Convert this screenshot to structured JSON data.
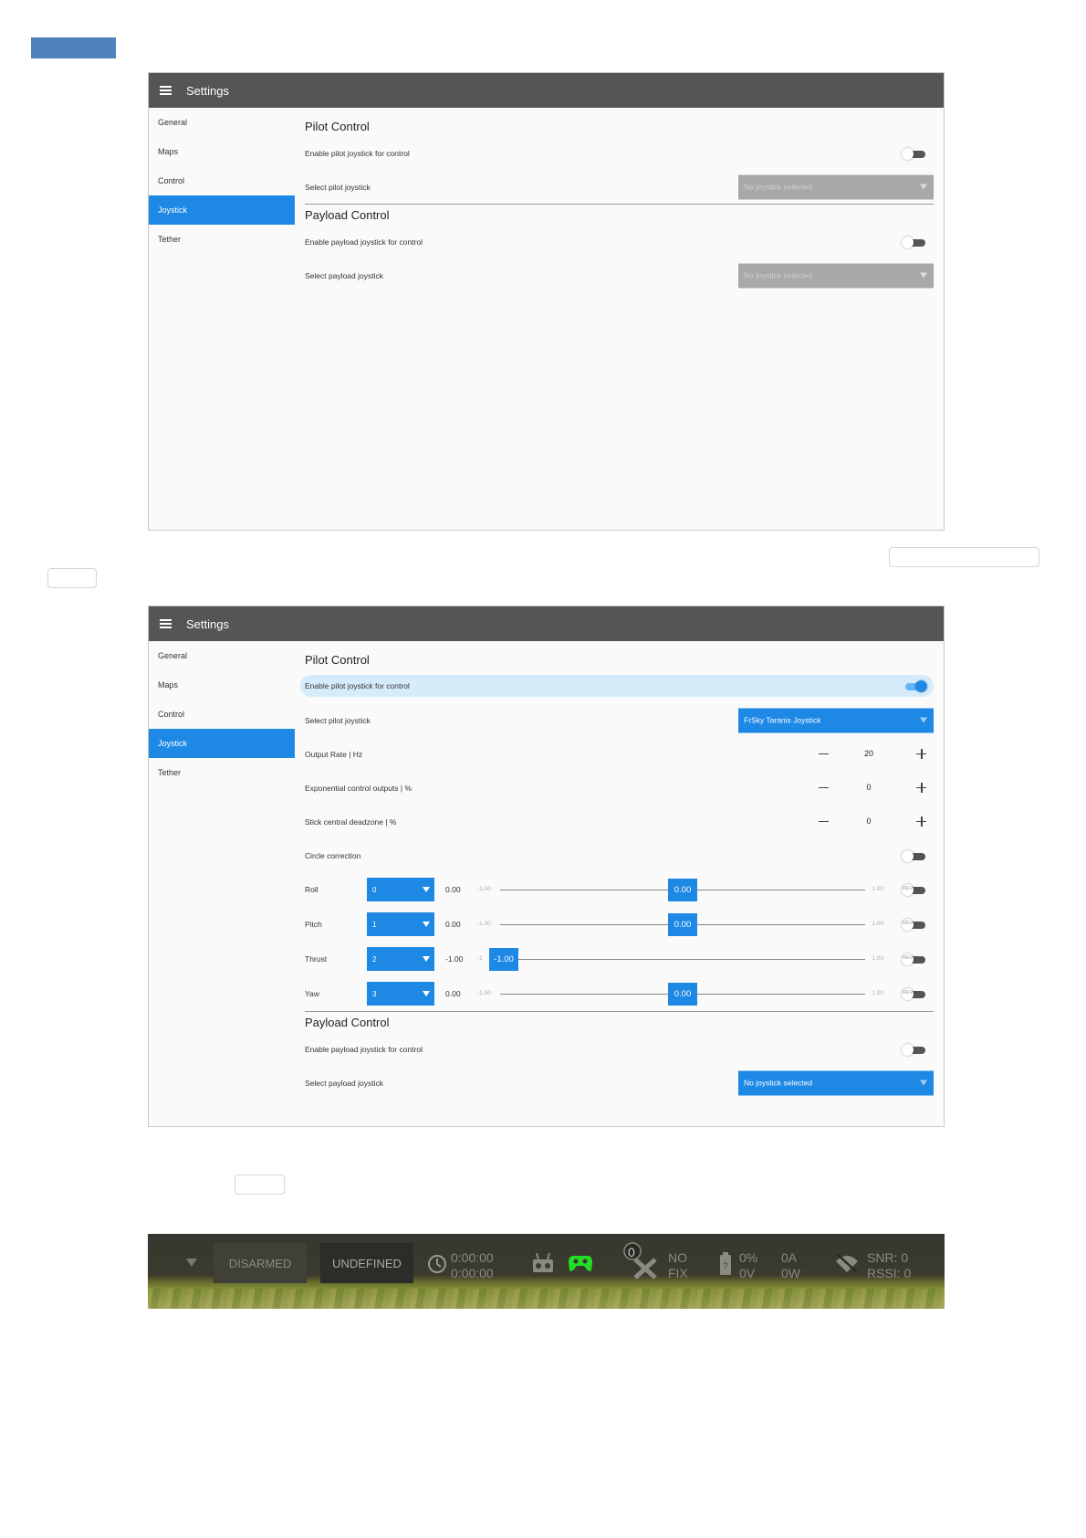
{
  "panel1": {
    "title": "Settings",
    "sidebar": [
      "General",
      "Maps",
      "Control",
      "Joystick",
      "Tether"
    ],
    "pilot": {
      "heading": "Pilot Control",
      "enable_label": "Enable pilot joystick for control",
      "select_label": "Select pilot joystick",
      "select_value": "No joystick selected"
    },
    "payload": {
      "heading": "Payload Control",
      "enable_label": "Enable payload joystick for control",
      "select_label": "Select payload joystick",
      "select_value": "No joystick selected"
    }
  },
  "panel2": {
    "title": "Settings",
    "sidebar": [
      "General",
      "Maps",
      "Control",
      "Joystick",
      "Tether"
    ],
    "pilot": {
      "heading": "Pilot Control",
      "enable_label": "Enable pilot joystick for control",
      "select_label": "Select pilot joystick",
      "select_value": "FrSky Taranis Joystick",
      "output_rate_label": "Output Rate | Hz",
      "output_rate_value": "20",
      "expo_label": "Exponential control outputs | %",
      "expo_value": "0",
      "deadzone_label": "Stick central deadzone | %",
      "deadzone_value": "0",
      "circle_label": "Circle correction"
    },
    "axes": [
      {
        "label": "Roll",
        "channel": "0",
        "value": "0.00",
        "min": "-1.00",
        "max": "1.00",
        "thumb": "0.00",
        "level": 0.0,
        "rev": "REV"
      },
      {
        "label": "Pitch",
        "channel": "1",
        "value": "0.00",
        "min": "-1.00",
        "max": "1.00",
        "thumb": "0.00",
        "level": 0.0,
        "rev": "REV"
      },
      {
        "label": "Thrust",
        "channel": "2",
        "value": "-1.00",
        "min": "-1",
        "max": "1.00",
        "thumb": "-1.00",
        "level": -1.0,
        "rev": "REV"
      },
      {
        "label": "Yaw",
        "channel": "3",
        "value": "0.00",
        "min": "-1.00",
        "max": "1.00",
        "thumb": "0.00",
        "level": 0.0,
        "rev": "REV"
      }
    ],
    "payload": {
      "heading": "Payload Control",
      "enable_label": "Enable payload joystick for control",
      "select_label": "Select payload joystick",
      "select_value": "No joystick selected"
    }
  },
  "status_bar": {
    "armed": "DISARMED",
    "mode": "UNDEFINED",
    "timer_1": "0:00:00",
    "timer_2": "0:00:00",
    "gps_sats": "0",
    "gps_fix_1": "NO",
    "gps_fix_2": "FIX",
    "battery_pct": "0%",
    "battery_v": "0V",
    "current_a": "0A",
    "power_w": "0W",
    "snr": "SNR: 0",
    "rssi": "RSSI: 0",
    "joystick_color": "#22dd22"
  }
}
